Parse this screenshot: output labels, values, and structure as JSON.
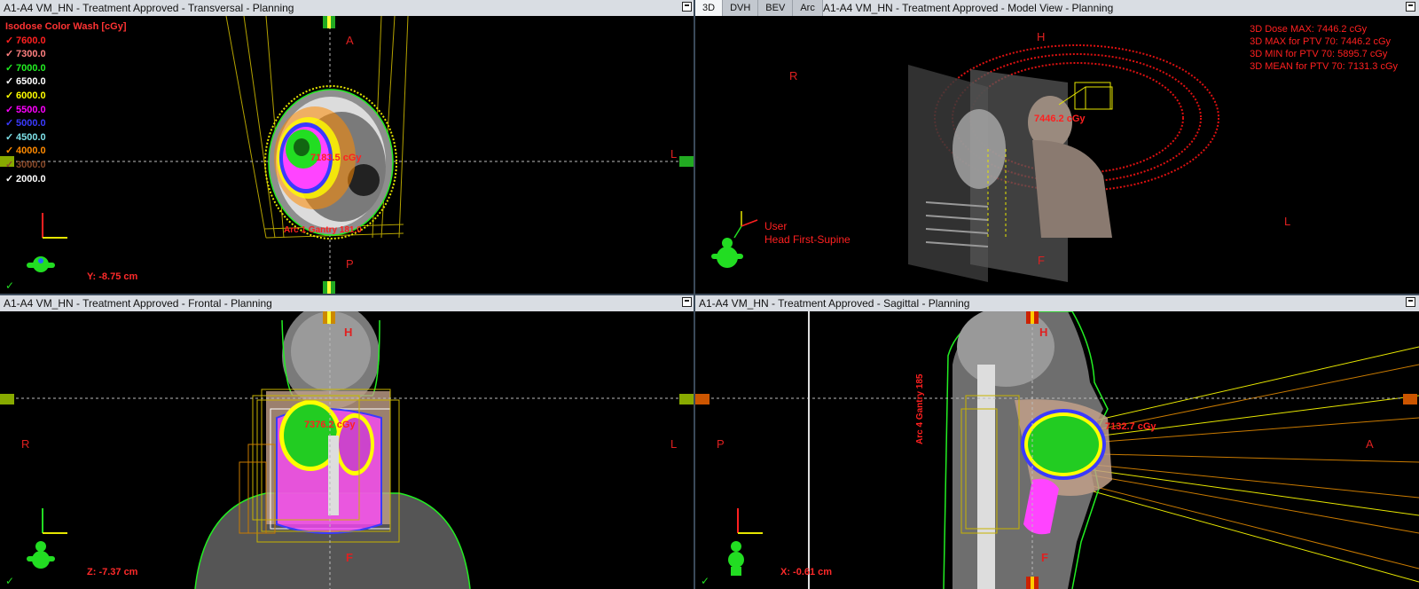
{
  "panes": {
    "transversal": {
      "title": "A1-A4 VM_HN  -  Treatment Approved - Transversal - Planning",
      "labels": {
        "anterior": "A",
        "posterior": "P",
        "left": "L"
      },
      "dose_label": "7183.5 cGy",
      "beam_label": "Arc 1 Gantry 181.0",
      "coordinate": "Y: -8.75 cm"
    },
    "model3d": {
      "tabs": [
        "3D",
        "DVH",
        "BEV",
        "Arc"
      ],
      "active_tab": "3D",
      "title": "A1-A4 VM_HN  -  Treatment Approved - Model View - Planning",
      "labels": {
        "head": "H",
        "right": "R",
        "left": "L",
        "feet": "F"
      },
      "dose_label": "7446.2 cGy",
      "orientation": [
        "User",
        "Head First-Supine"
      ],
      "stats": [
        "3D Dose MAX: 7446.2 cGy",
        "3D MAX for PTV 70: 7446.2 cGy",
        "3D MIN for PTV 70: 5895.7 cGy",
        "3D MEAN for PTV 70: 7131.3 cGy"
      ]
    },
    "frontal": {
      "title": "A1-A4 VM_HN  -  Treatment Approved - Frontal - Planning",
      "labels": {
        "head": "H",
        "right": "R",
        "left": "L",
        "feet": "F"
      },
      "dose_label": "7376.2 cGy",
      "coordinate": "Z: -7.37 cm"
    },
    "sagittal": {
      "title": "A1-A4 VM_HN  -  Treatment Approved - Sagittal - Planning",
      "labels": {
        "head": "H",
        "posterior": "P",
        "anterior": "A",
        "feet": "F"
      },
      "dose_label": "7132.7 cGy",
      "beam_label": "Arc 4 Gantry 185",
      "coordinate": "X: -0.61 cm"
    }
  },
  "isodose_legend": {
    "header": "Isodose Color Wash [cGy]",
    "levels": [
      {
        "value": "7600.0",
        "color": "#ff2020"
      },
      {
        "value": "7300.0",
        "color": "#ff8080"
      },
      {
        "value": "7000.0",
        "color": "#22ee22"
      },
      {
        "value": "6500.0",
        "color": "#ffffff"
      },
      {
        "value": "6000.0",
        "color": "#ffff00"
      },
      {
        "value": "5500.0",
        "color": "#ff00ff"
      },
      {
        "value": "5000.0",
        "color": "#3a3aff"
      },
      {
        "value": "4500.0",
        "color": "#7ee0e8"
      },
      {
        "value": "4000.0",
        "color": "#ff8a00"
      },
      {
        "value": "3000.0",
        "color": "#8a4a2a"
      },
      {
        "value": "2000.0",
        "color": "#ffffff"
      }
    ]
  },
  "check_icon": "✓"
}
